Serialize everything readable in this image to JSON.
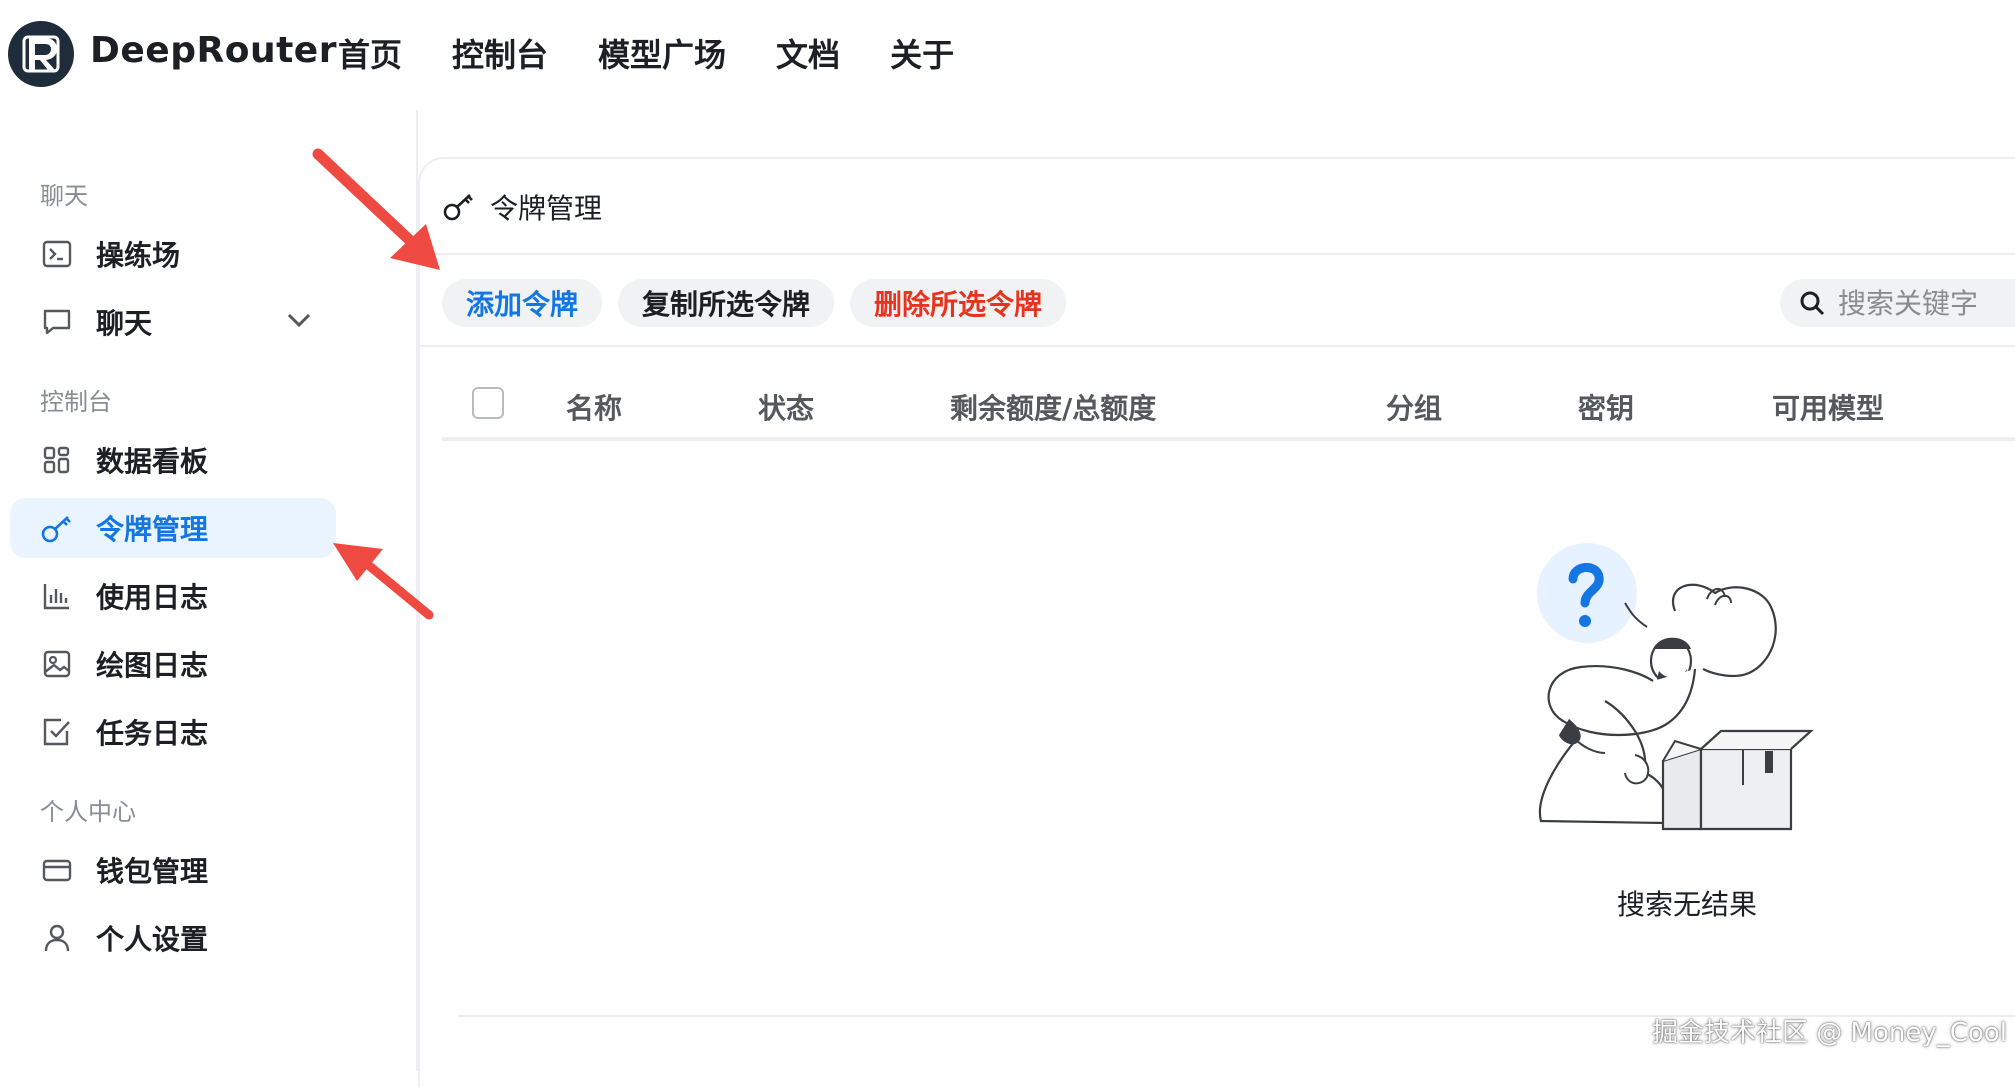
{
  "brand": {
    "name": "DeepRouter"
  },
  "nav": {
    "items": [
      "首页",
      "控制台",
      "模型广场",
      "文档",
      "关于"
    ]
  },
  "sidebar": {
    "sections": [
      {
        "title": "聊天",
        "items": [
          {
            "label": "操练场",
            "icon": "terminal-icon"
          },
          {
            "label": "聊天",
            "icon": "chat-bubble-icon",
            "expandable": true
          }
        ]
      },
      {
        "title": "控制台",
        "items": [
          {
            "label": "数据看板",
            "icon": "grid-icon"
          },
          {
            "label": "令牌管理",
            "icon": "key-icon",
            "active": true
          },
          {
            "label": "使用日志",
            "icon": "bar-chart-icon"
          },
          {
            "label": "绘图日志",
            "icon": "image-icon"
          },
          {
            "label": "任务日志",
            "icon": "checkbox-icon"
          }
        ]
      },
      {
        "title": "个人中心",
        "items": [
          {
            "label": "钱包管理",
            "icon": "wallet-icon"
          },
          {
            "label": "个人设置",
            "icon": "user-icon"
          }
        ]
      }
    ]
  },
  "panel": {
    "title": "令牌管理",
    "toolbar": {
      "add": "添加令牌",
      "copy": "复制所选令牌",
      "delete": "删除所选令牌"
    },
    "search": {
      "placeholder": "搜索关键字",
      "value": ""
    },
    "columns": [
      "名称",
      "状态",
      "剩余额度/总额度",
      "分组",
      "密钥",
      "可用模型"
    ],
    "empty": {
      "text": "搜索无结果"
    }
  },
  "watermark": "掘金技术社区 @ Money_Cool",
  "colors": {
    "accent": "#1476e3",
    "danger": "#e8331f",
    "active_bg": "#eaf4ff",
    "annotation_arrow": "#ef4a42"
  }
}
